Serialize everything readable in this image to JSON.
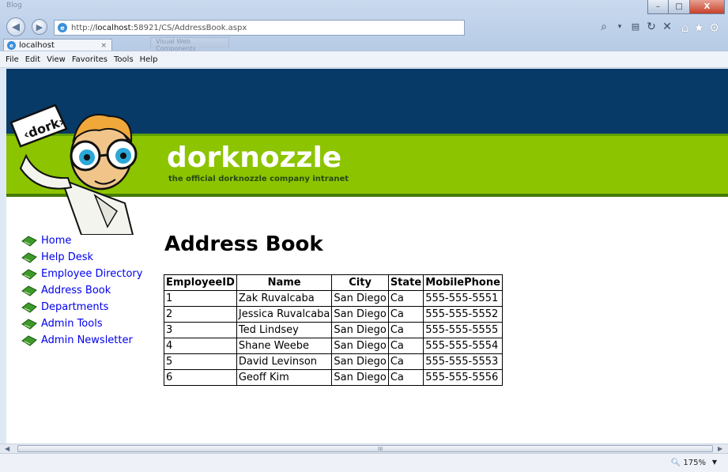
{
  "window": {
    "title_ghost": "Blog",
    "controls": {
      "minimize": "–",
      "maximize": "□",
      "close": "X"
    }
  },
  "nav": {
    "back_icon": "arrow-left-icon",
    "forward_icon": "arrow-right-icon"
  },
  "address": {
    "url_prefix": "http://",
    "url_host": "localhost",
    "url_rest": ":58921/CS/AddressBook.aspx"
  },
  "tabs": {
    "active_label": "localhost",
    "close_label": "×",
    "ghost_label": "Visual Web Components"
  },
  "toolbar_icons": [
    "search-icon",
    "dropdown-icon",
    "compatibility-icon",
    "refresh-icon",
    "stop-icon"
  ],
  "right_icons": [
    "home-icon",
    "favorites-star-icon",
    "settings-gear-icon"
  ],
  "menu": [
    "File",
    "Edit",
    "View",
    "Favorites",
    "Tools",
    "Help"
  ],
  "banner": {
    "site_name": "dorknozzle",
    "tagline": "the official dorknozzle company intranet",
    "sign_text": "‹dork›",
    "colors": {
      "top": "#083a67",
      "green": "#8cc400"
    }
  },
  "sidebar": {
    "items": [
      {
        "label": "Home"
      },
      {
        "label": "Help Desk"
      },
      {
        "label": "Employee Directory"
      },
      {
        "label": "Address Book"
      },
      {
        "label": "Departments"
      },
      {
        "label": "Admin Tools"
      },
      {
        "label": "Admin Newsletter"
      }
    ]
  },
  "main": {
    "title": "Address Book",
    "table": {
      "headers": [
        "EmployeeID",
        "Name",
        "City",
        "State",
        "MobilePhone"
      ],
      "rows": [
        [
          "1",
          "Zak Ruvalcaba",
          "San Diego",
          "Ca",
          "555-555-5551"
        ],
        [
          "2",
          "Jessica Ruvalcaba",
          "San Diego",
          "Ca",
          "555-555-5552"
        ],
        [
          "3",
          "Ted Lindsey",
          "San Diego",
          "Ca",
          "555-555-5555"
        ],
        [
          "4",
          "Shane Weebe",
          "San Diego",
          "Ca",
          "555-555-5554"
        ],
        [
          "5",
          "David Levinson",
          "San Diego",
          "Ca",
          "555-555-5553"
        ],
        [
          "6",
          "Geoff Kim",
          "San Diego",
          "Ca",
          "555-555-5556"
        ]
      ]
    }
  },
  "scrollbar": {
    "grip": "III"
  },
  "status": {
    "zoom": "175%"
  }
}
